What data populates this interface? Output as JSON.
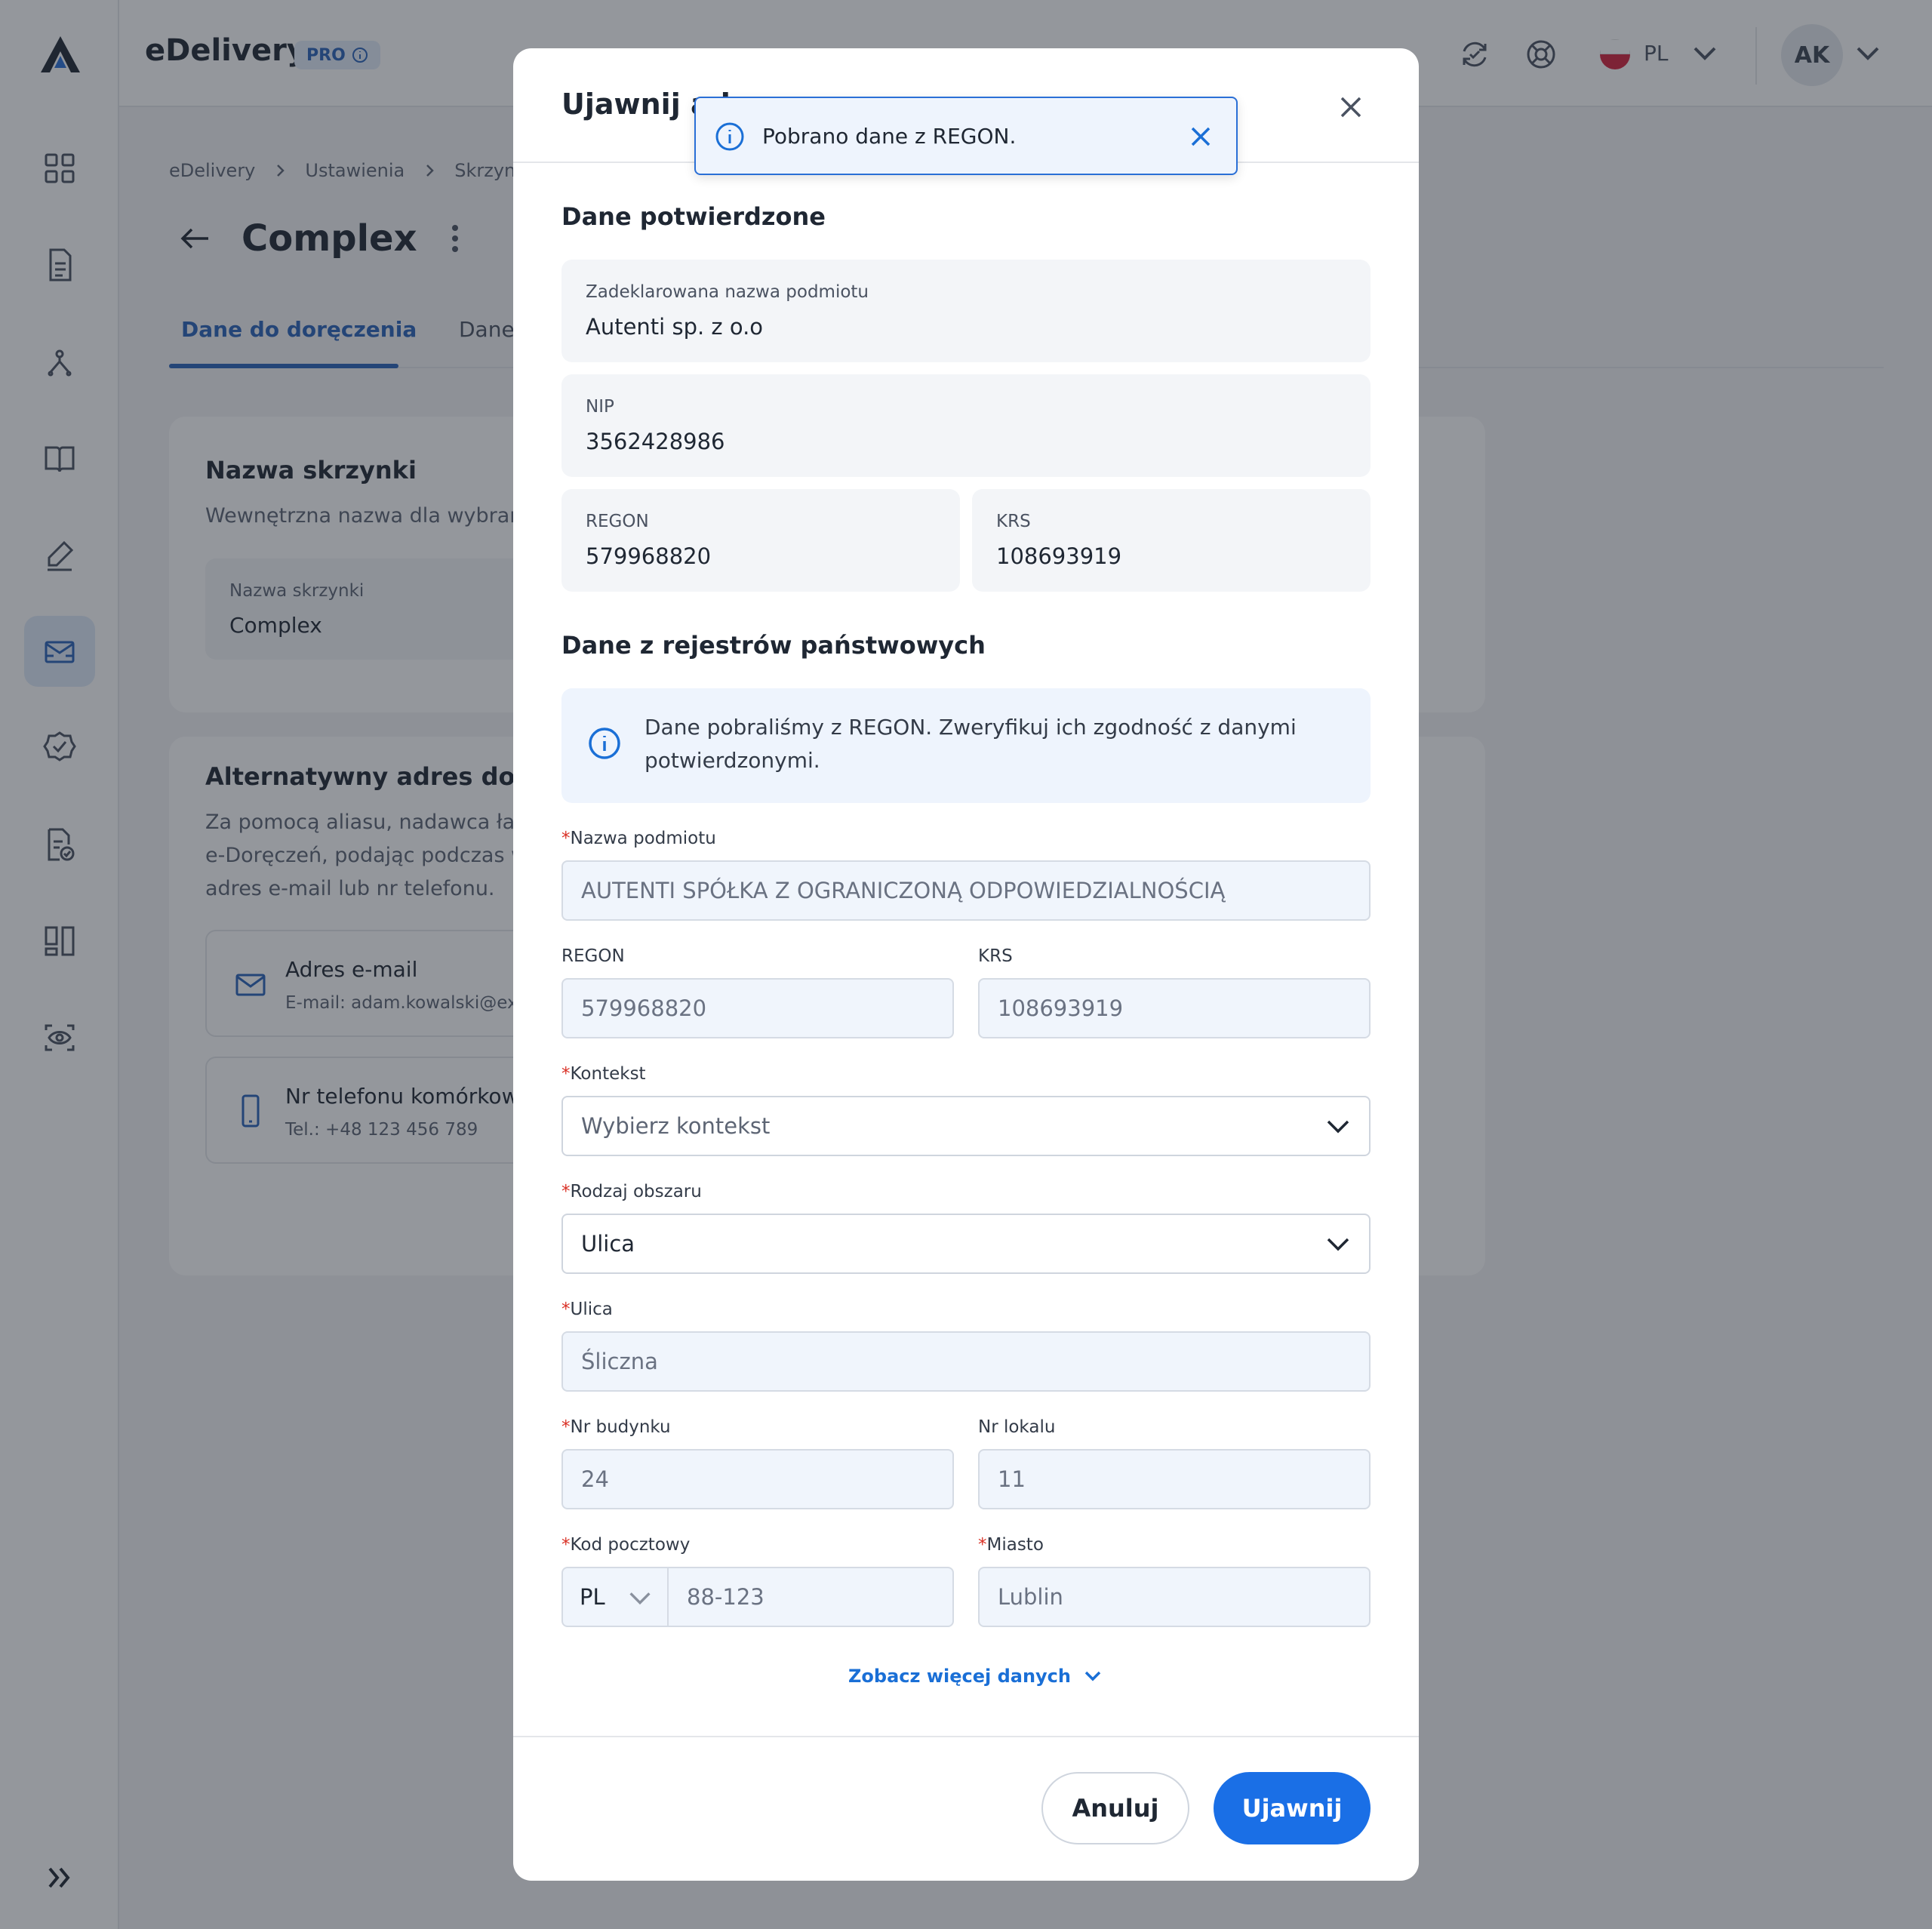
{
  "app": {
    "brand": "eDelivery",
    "plan_badge": "PRO",
    "language": "PL",
    "user_initials": "AK"
  },
  "breadcrumb": [
    "eDelivery",
    "Ustawienia",
    "Skrzynki"
  ],
  "page": {
    "title": "Complex",
    "tabs": [
      {
        "label": "Dane do doręczenia",
        "active": true
      },
      {
        "label": "Dane",
        "active": false
      }
    ]
  },
  "mailbox_card": {
    "title": "Nazwa skrzynki",
    "description": "Wewnętrzna nazwa dla wybrane",
    "field_label": "Nazwa skrzynki",
    "field_value": "Complex"
  },
  "alias_card": {
    "title": "Alternatywny adres do e-D",
    "description_lines": [
      "Za pomocą aliasu, nadawca łatw",
      "e-Doręczeń, podając podczas w",
      "adres e-mail lub nr telefonu."
    ],
    "items": [
      {
        "title": "Adres e-mail",
        "subtitle": "E-mail: adam.kowalski@exa",
        "icon": "mail-icon"
      },
      {
        "title": "Nr telefonu komórkowe",
        "subtitle": "Tel.: +48 123 456 789",
        "icon": "phone-icon"
      }
    ]
  },
  "modal": {
    "title": "Ujawnij ad",
    "confirmed_section": {
      "title": "Dane potwierdzone",
      "declared_name_label": "Zadeklarowana nazwa podmiotu",
      "declared_name_value": "Autenti sp. z o.o",
      "nip_label": "NIP",
      "nip_value": "3562428986",
      "regon_label": "REGON",
      "regon_value": "579968820",
      "krs_label": "KRS",
      "krs_value": "108693919"
    },
    "registry_section": {
      "title": "Dane z rejestrów państwowych",
      "info_text": "Dane pobraliśmy z REGON. Zweryfikuj ich zgodność z danymi potwierdzonymi."
    },
    "form": {
      "entity_name_label": "Nazwa podmiotu",
      "entity_name_value": "AUTENTI SPÓŁKA Z OGRANICZONĄ ODPOWIEDZIALNOŚCIĄ",
      "regon_label": "REGON",
      "regon_value": "579968820",
      "krs_label": "KRS",
      "krs_value": "108693919",
      "context_label": "Kontekst",
      "context_placeholder": "Wybierz kontekst",
      "area_type_label": "Rodzaj obszaru",
      "area_type_value": "Ulica",
      "street_label": "Ulica",
      "street_value": "Śliczna",
      "building_label": "Nr budynku",
      "building_value": "24",
      "unit_label": "Nr lokalu",
      "unit_value": "11",
      "postal_label": "Kod pocztowy",
      "postal_country": "PL",
      "postal_value": "88-123",
      "city_label": "Miasto",
      "city_value": "Lublin",
      "required_mark": "*"
    },
    "show_more_label": "Zobacz więcej danych",
    "cancel_label": "Anuluj",
    "submit_label": "Ujawnij"
  },
  "toast": {
    "message": "Pobrano dane z REGON."
  },
  "colors": {
    "primary": "#1a6fe6",
    "link": "#1a6fd6",
    "required": "#d93025",
    "overlay": "rgba(31,37,48,0.48)"
  }
}
